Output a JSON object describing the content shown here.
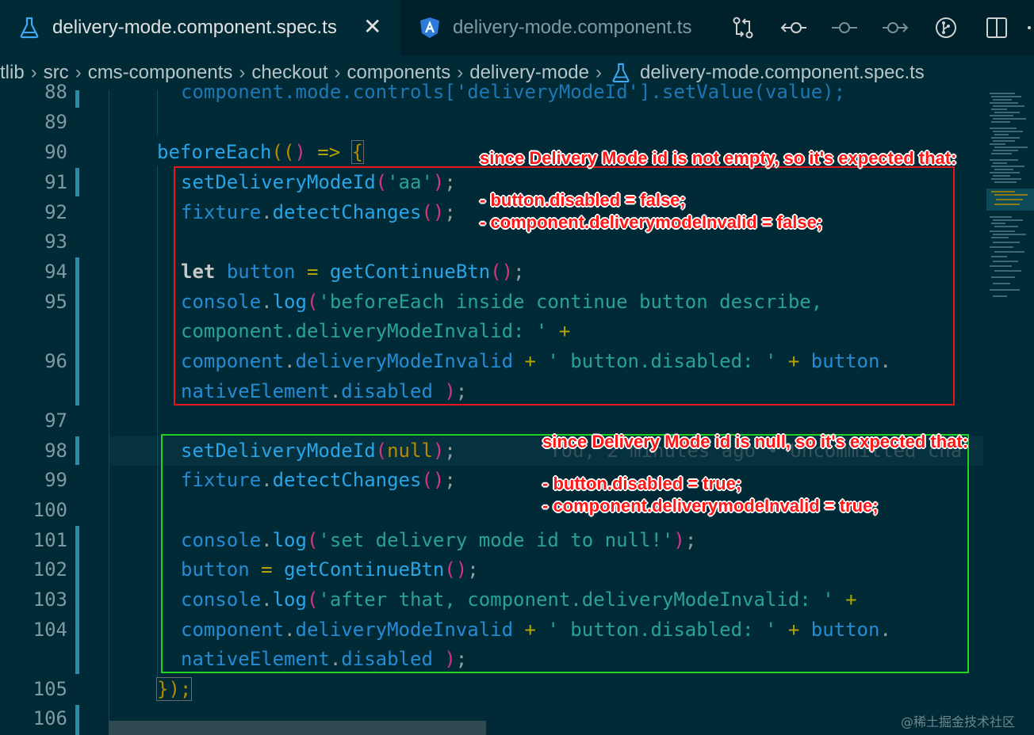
{
  "tabs": [
    {
      "label": "delivery-mode.component.spec.ts",
      "icon": "flask-icon",
      "active": true
    },
    {
      "label": "delivery-mode.component.ts",
      "icon": "angular-icon",
      "active": false
    }
  ],
  "toolbar_icons": [
    "compare-changes-icon",
    "go-back-icon",
    "go-to-commit-icon",
    "go-forward-icon",
    "git-branch-icon",
    "split-editor-icon",
    "more-icon"
  ],
  "breadcrumb": [
    "tlib",
    "src",
    "cms-components",
    "checkout",
    "components",
    "delivery-mode",
    "delivery-mode.component.spec.ts"
  ],
  "line_numbers": [
    "88",
    "89",
    "90",
    "91",
    "92",
    "93",
    "94",
    "95",
    "96",
    "97",
    "98",
    "99",
    "100",
    "101",
    "102",
    "103",
    "104",
    "105",
    "106"
  ],
  "code": {
    "l88": "component.mode.controls['deliveryModeId'].setValue(value);",
    "beforeEach": "beforeEach",
    "paren_open": "((",
    "paren_close": ")",
    "arrow": " => ",
    "brace": "{",
    "setDeliveryModeId": "setDeliveryModeId",
    "aa": "'aa'",
    "fixture": "fixture",
    "detectChanges": "detectChanges",
    "let": "let",
    "button": "button",
    "eq": " = ",
    "getContinueBtn": "getContinueBtn",
    "console": "console",
    "log": "log",
    "str95": "'beforeEach inside continue button describe,",
    "str95b": "component.deliveryModeInvalid: '",
    "plus": " +",
    "component": "component",
    "deliveryModeInvalid": "deliveryModeInvalid",
    "str_btn_disabled": "' button.disabled: '",
    "nativeElement": "nativeElement",
    "disabled": "disabled",
    "null": "null",
    "str101": "'set delivery mode id to null!'",
    "str103": "'after that, component.deliveryModeInvalid: '",
    "close105": "});"
  },
  "ghost_text": "You, 2 minutes ago • Uncommitted cha",
  "annotations": {
    "red_title": "since Delivery Mode id is not empty, so it's expected that:",
    "red_line1": "- button.disabled = false;",
    "red_line2": "- component.deliverymodeInvalid = false;",
    "green_title": "since Delivery Mode id is null, so it's expected that:",
    "green_line1": "- button.disabled = true;",
    "green_line2": "- component.deliverymodeInvalid = true;"
  },
  "watermark": "@稀土掘金技术社区",
  "colors": {
    "editor_bg": "#002b36",
    "red_box": "#e8161c",
    "green_box": "#21d321"
  }
}
